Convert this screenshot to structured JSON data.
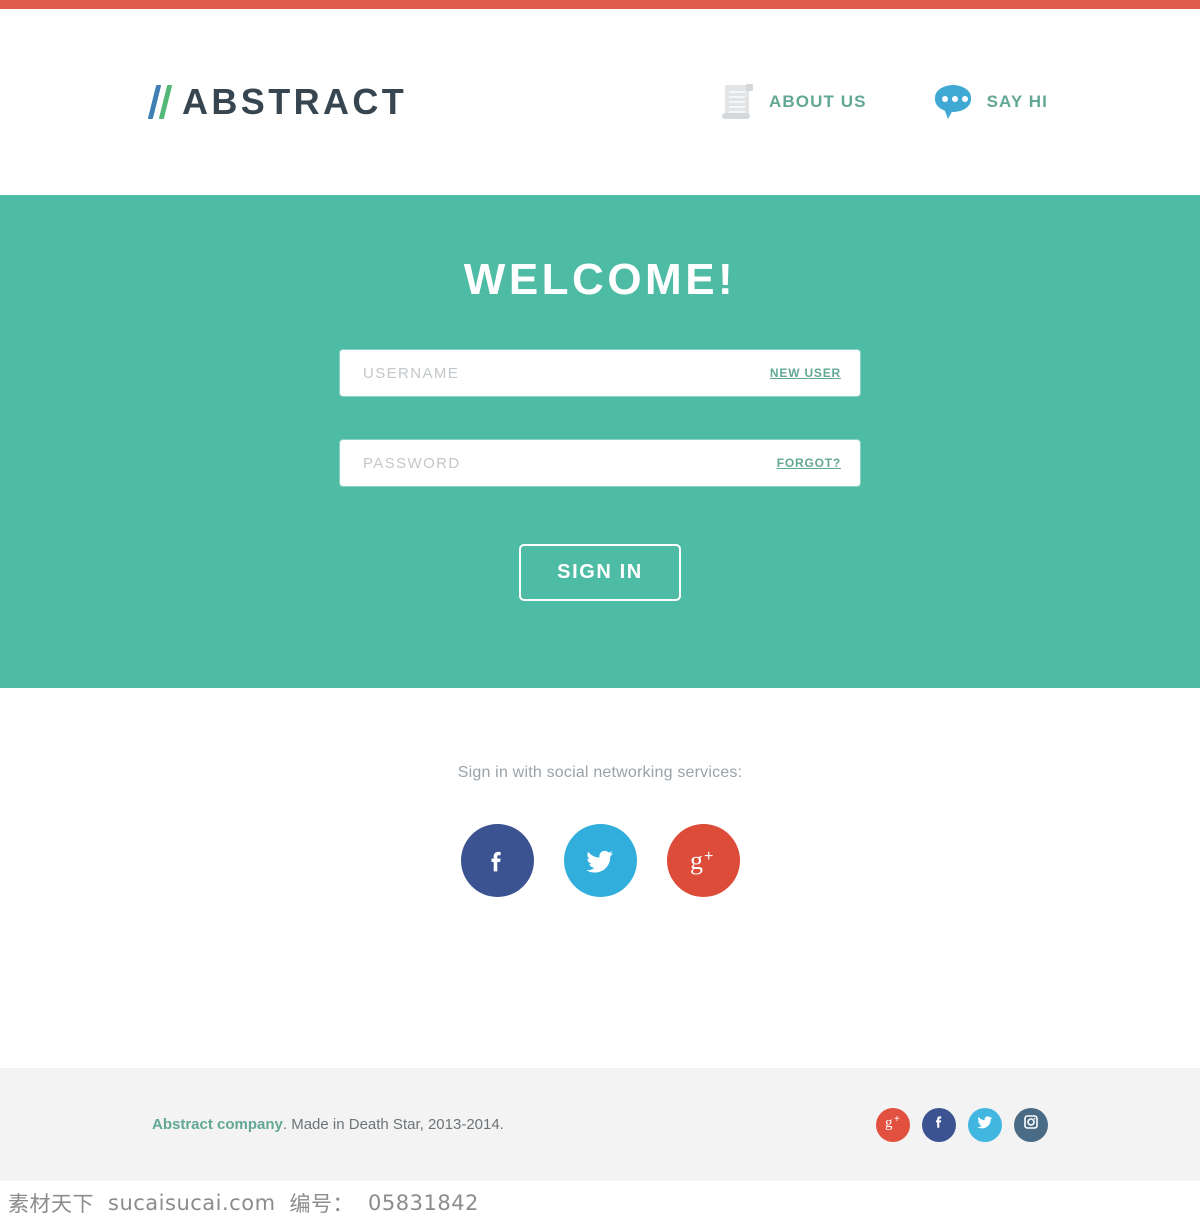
{
  "theme": {
    "accent_bar": "#dd5c4e",
    "hero_background": "#4ebba4",
    "teal_text": "#62a894",
    "logo_text": "#36454f",
    "footer_background": "#f3f3f3"
  },
  "header": {
    "logo": {
      "slash_mark": "//",
      "text": "ABSTRACT",
      "slash_color_1": "#3f7fb5",
      "slash_color_2": "#54b878"
    },
    "nav": [
      {
        "label": "ABOUT US",
        "icon": "scroll-icon"
      },
      {
        "label": "SAY HI",
        "icon": "speech-bubble-icon"
      }
    ]
  },
  "hero": {
    "title": "WELCOME!",
    "username_field": {
      "placeholder": "USERNAME",
      "value": "",
      "link_label": "NEW USER"
    },
    "password_field": {
      "placeholder": "PASSWORD",
      "value": "",
      "link_label": "FORGOT?"
    },
    "submit_label": "SIGN IN"
  },
  "social_login": {
    "caption": "Sign in with social networking services:",
    "buttons": [
      {
        "name": "facebook",
        "label": "f",
        "color": "#3b5391"
      },
      {
        "name": "twitter",
        "label": "twitter-bird",
        "color": "#32aedd"
      },
      {
        "name": "google-plus",
        "label": "g+",
        "color": "#dd4b39"
      }
    ]
  },
  "footer": {
    "brand": "Abstract company",
    "copyright": ". Made in Death Star, 2013-2014.",
    "social": [
      {
        "name": "google-plus",
        "color": "#e2513f"
      },
      {
        "name": "facebook",
        "color": "#3b5391"
      },
      {
        "name": "twitter",
        "color": "#41b6e0"
      },
      {
        "name": "instagram",
        "color": "#4a6b86"
      }
    ]
  },
  "watermark": {
    "site_cn": "素材天下",
    "site_url": "sucaisucai.com",
    "id_label": "编号：",
    "id_value": "05831842"
  }
}
